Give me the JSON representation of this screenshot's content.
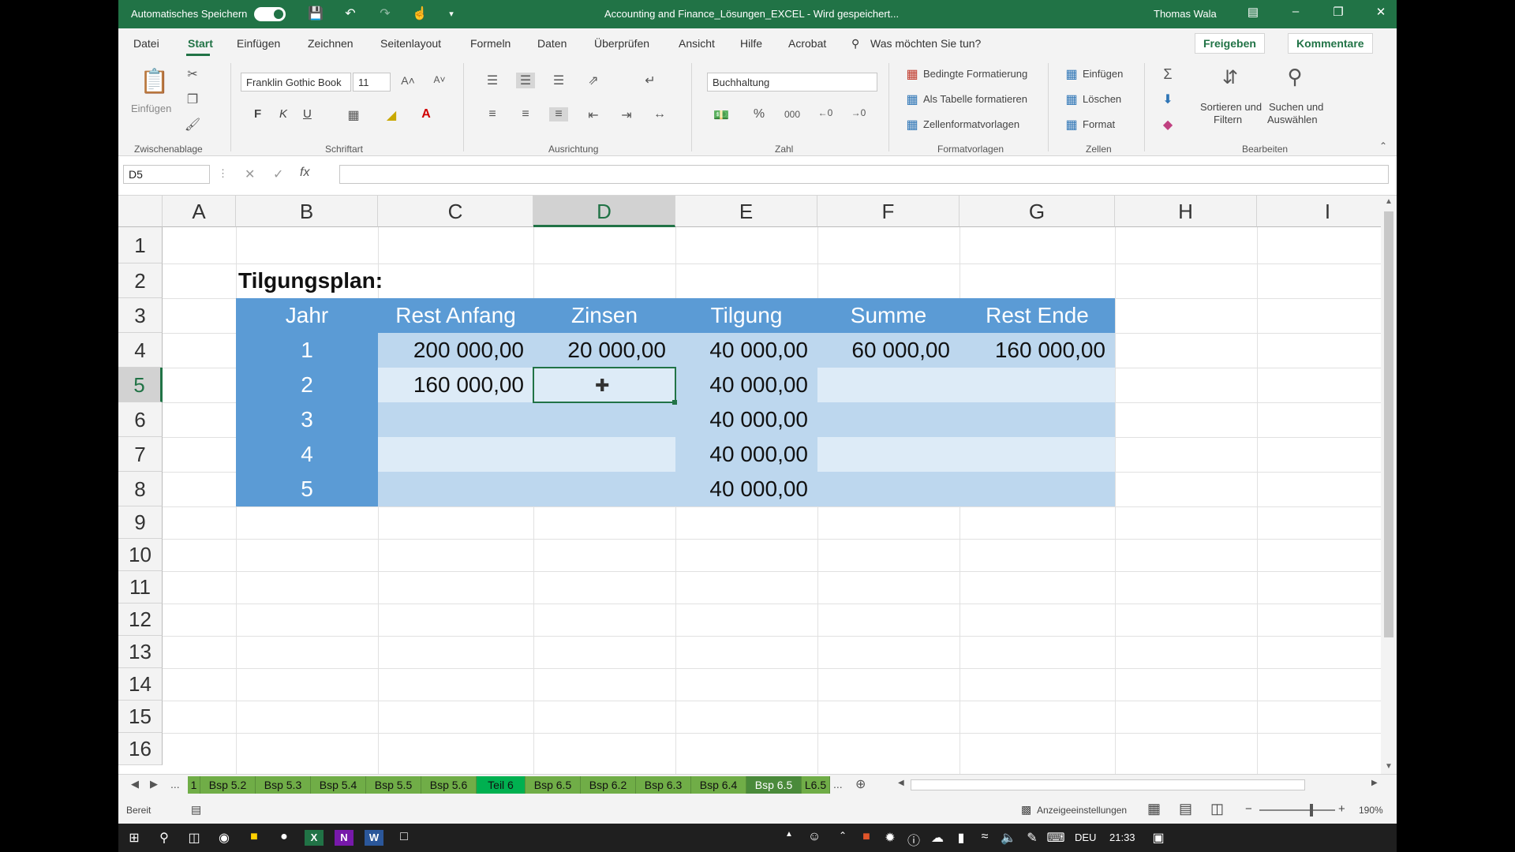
{
  "title": {
    "autosave_label": "Automatisches Speichern",
    "document": "Accounting and Finance_Lösungen_EXCEL - Wird gespeichert...",
    "user": "Thomas Wala"
  },
  "menu": {
    "items": [
      "Datei",
      "Start",
      "Einfügen",
      "Zeichnen",
      "Seitenlayout",
      "Formeln",
      "Daten",
      "Überprüfen",
      "Ansicht",
      "Hilfe",
      "Acrobat"
    ],
    "search": "Was möchten Sie tun?",
    "share": "Freigeben",
    "comments": "Kommentare"
  },
  "ribbon": {
    "paste": "Einfügen",
    "clipboard_group": "Zwischenablage",
    "font_name": "Franklin Gothic Book",
    "font_size": "11",
    "bold": "F",
    "italic": "K",
    "underline": "U",
    "font_group": "Schriftart",
    "align_group": "Ausrichtung",
    "number_format": "Buchhaltung",
    "number_group": "Zahl",
    "cond_format": "Bedingte Formatierung",
    "as_table": "Als Tabelle formatieren",
    "cell_styles": "Zellenformatvorlagen",
    "styles_group": "Formatvorlagen",
    "insert": "Einfügen",
    "delete": "Löschen",
    "format": "Format",
    "cells_group": "Zellen",
    "sort_filter_1": "Sortieren und",
    "sort_filter_2": "Filtern",
    "find_1": "Suchen und",
    "find_2": "Auswählen",
    "edit_group": "Bearbeiten"
  },
  "formula_bar": {
    "name_box": "D5",
    "fx": "fx",
    "formula": ""
  },
  "columns": [
    "A",
    "B",
    "C",
    "D",
    "E",
    "F",
    "G",
    "H",
    "I"
  ],
  "rows": [
    "1",
    "2",
    "3",
    "4",
    "5",
    "6",
    "7",
    "8",
    "9",
    "10",
    "11",
    "12",
    "13",
    "14",
    "15",
    "16"
  ],
  "sheet": {
    "title": "Tilgungsplan:",
    "headers": [
      "Jahr",
      "Rest Anfang",
      "Zinsen",
      "Tilgung",
      "Summe",
      "Rest Ende"
    ],
    "data": [
      [
        "1",
        "200 000,00",
        "20 000,00",
        "40 000,00",
        "60 000,00",
        "160 000,00"
      ],
      [
        "2",
        "160 000,00",
        "",
        "40 000,00",
        "",
        ""
      ],
      [
        "3",
        "",
        "",
        "40 000,00",
        "",
        ""
      ],
      [
        "4",
        "",
        "",
        "40 000,00",
        "",
        ""
      ],
      [
        "5",
        "",
        "",
        "40 000,00",
        "",
        ""
      ]
    ]
  },
  "tabs": [
    "1",
    "Bsp 5.2",
    "Bsp 5.3",
    "Bsp 5.4",
    "Bsp 5.5",
    "Bsp 5.6",
    "Teil 6",
    "Bsp 6.5",
    "Bsp 6.2",
    "Bsp 6.3",
    "Bsp 6.4",
    "Bsp 6.5",
    "L6.5"
  ],
  "tabs_more": "...",
  "status": {
    "ready": "Bereit",
    "display_settings": "Anzeigeeinstellungen",
    "zoom": "190%"
  },
  "taskbar": {
    "lang": "DEU",
    "time": "21:33"
  },
  "colors": {
    "excel_green": "#217346",
    "table_header": "#5b9bd5",
    "band_light": "#ddebf7",
    "band_dark": "#bdd7ee"
  }
}
